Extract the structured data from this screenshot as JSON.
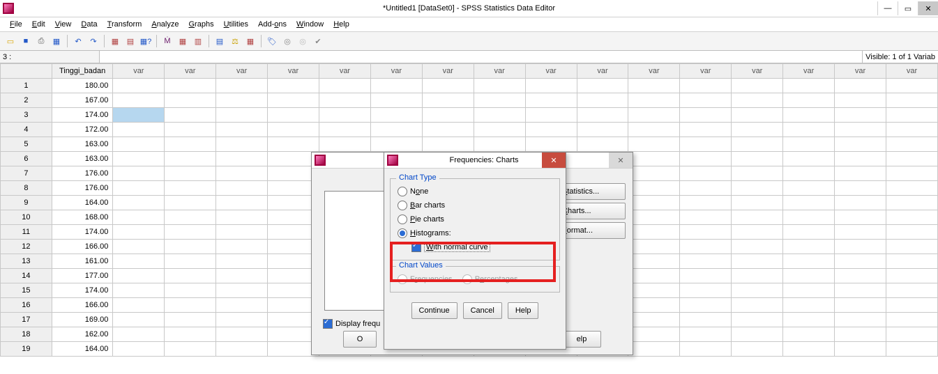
{
  "window": {
    "title": "*Untitled1 [DataSet0] - SPSS Statistics Data Editor",
    "min": "—",
    "max": "▭",
    "close": "✕"
  },
  "menus": {
    "file": "File",
    "edit": "Edit",
    "view": "View",
    "data": "Data",
    "transform": "Transform",
    "analyze": "Analyze",
    "graphs": "Graphs",
    "utilities": "Utilities",
    "addons": "Add-ons",
    "window": "Window",
    "help": "Help"
  },
  "addr": {
    "label": "3 :",
    "visible": "Visible: 1 of 1 Variab"
  },
  "columns": {
    "data": "Tinggi_badan",
    "var": "var"
  },
  "rows": [
    {
      "n": "1",
      "v": "180.00"
    },
    {
      "n": "2",
      "v": "167.00"
    },
    {
      "n": "3",
      "v": "174.00"
    },
    {
      "n": "4",
      "v": "172.00"
    },
    {
      "n": "5",
      "v": "163.00"
    },
    {
      "n": "6",
      "v": "163.00"
    },
    {
      "n": "7",
      "v": "176.00"
    },
    {
      "n": "8",
      "v": "176.00"
    },
    {
      "n": "9",
      "v": "164.00"
    },
    {
      "n": "10",
      "v": "168.00"
    },
    {
      "n": "11",
      "v": "174.00"
    },
    {
      "n": "12",
      "v": "166.00"
    },
    {
      "n": "13",
      "v": "161.00"
    },
    {
      "n": "14",
      "v": "177.00"
    },
    {
      "n": "15",
      "v": "174.00"
    },
    {
      "n": "16",
      "v": "166.00"
    },
    {
      "n": "17",
      "v": "169.00"
    },
    {
      "n": "18",
      "v": "162.00"
    },
    {
      "n": "19",
      "v": "164.00"
    }
  ],
  "freq_dialog": {
    "display_freq": "Display frequ",
    "stats_btn": "Statistics...",
    "charts_btn": "Charts...",
    "format_btn": "Format...",
    "o_btn": "O",
    "elp_btn": "elp"
  },
  "charts_dialog": {
    "title": "Frequencies: Charts",
    "chart_type_legend": "Chart Type",
    "none": "None",
    "bar": "Bar charts",
    "pie": "Pie charts",
    "hist": "Histograms:",
    "normal": "With normal curve",
    "chart_values_legend": "Chart Values",
    "freq": "Frequencies",
    "pct": "Percentages",
    "continue": "Continue",
    "cancel": "Cancel",
    "help": "Help"
  }
}
